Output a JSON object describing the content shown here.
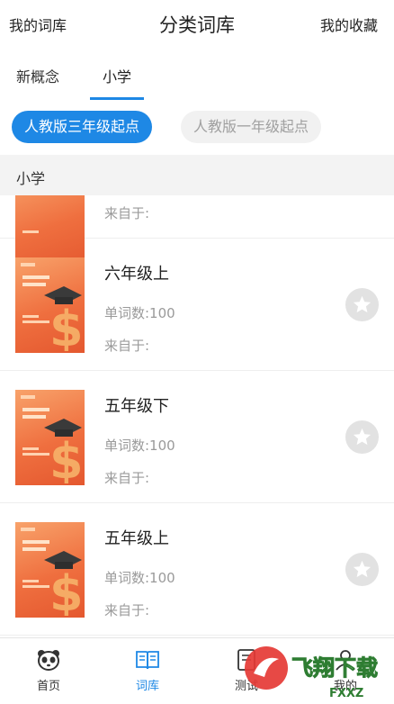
{
  "header": {
    "left_label": "我的词库",
    "title": "分类词库",
    "right_label": "我的收藏"
  },
  "tabs": [
    {
      "label": "新概念",
      "active": false
    },
    {
      "label": "小学",
      "active": true
    }
  ],
  "filters": [
    {
      "label": "人教版三年级起点",
      "active": true
    },
    {
      "label": "人教版一年级起点",
      "active": false
    }
  ],
  "section": {
    "title": "小学"
  },
  "books": [
    {
      "title": "",
      "count": "",
      "from": "来自于:"
    },
    {
      "title": "六年级上",
      "count": "单词数:100",
      "from": "来自于:"
    },
    {
      "title": "五年级下",
      "count": "单词数:100",
      "from": "来自于:"
    },
    {
      "title": "五年级上",
      "count": "单词数:100",
      "from": "来自于:"
    }
  ],
  "bottom_nav": [
    {
      "label": "首页",
      "icon": "panda-icon",
      "active": false
    },
    {
      "label": "词库",
      "icon": "book-icon",
      "active": true
    },
    {
      "label": "测试",
      "icon": "test-icon",
      "active": false
    },
    {
      "label": "我的",
      "icon": "user-icon",
      "active": false
    }
  ],
  "watermark": {
    "text": "飞翔下载",
    "sub": "FXXZ"
  },
  "colors": {
    "accent": "#1e88e5",
    "cover": "#ef6f3f",
    "divider": "#eeeeee"
  }
}
